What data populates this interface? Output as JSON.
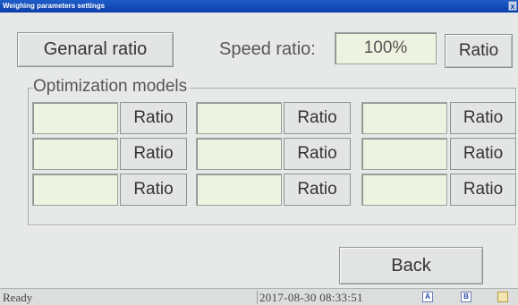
{
  "window": {
    "title": "Weighing parameters settings",
    "close_glyph": "x"
  },
  "top_row": {
    "general_ratio_button": "Genaral ratio",
    "speed_ratio_label": "Speed ratio:",
    "speed_ratio_value": "100%",
    "ratio_button": "Ratio"
  },
  "optimization": {
    "legend": "Optimization models",
    "rows": [
      [
        {
          "value": "",
          "button": "Ratio"
        },
        {
          "value": "",
          "button": "Ratio"
        },
        {
          "value": "",
          "button": "Ratio"
        }
      ],
      [
        {
          "value": "",
          "button": "Ratio"
        },
        {
          "value": "",
          "button": "Ratio"
        },
        {
          "value": "",
          "button": "Ratio"
        }
      ],
      [
        {
          "value": "",
          "button": "Ratio"
        },
        {
          "value": "",
          "button": "Ratio"
        },
        {
          "value": "",
          "button": "Ratio"
        }
      ]
    ]
  },
  "back_button": "Back",
  "status": {
    "text": "Ready",
    "datetime": "2017-08-30 08:33:51",
    "icons": [
      {
        "name": "a-indicator-icon",
        "label": "A"
      },
      {
        "name": "b-indicator-icon",
        "label": "B"
      },
      {
        "name": "c-indicator-icon",
        "label": ""
      }
    ]
  }
}
